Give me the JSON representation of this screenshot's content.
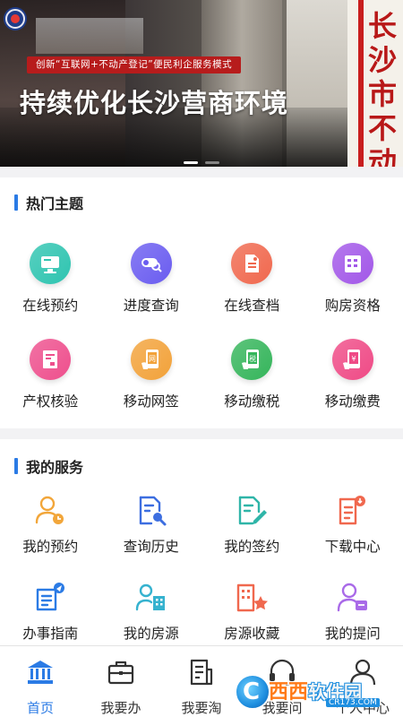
{
  "banner": {
    "slogan": "创新“互联网+不动产登记”便民利企服务模式",
    "headline": "持续优化长沙营商环境",
    "sign_text": "长沙市不动产",
    "slides": 2,
    "active_slide": 0
  },
  "hot_topics": {
    "title": "热门主题",
    "items": [
      {
        "label": "在线预约",
        "icon": "monitor-icon",
        "color": "#2ec4b0"
      },
      {
        "label": "进度查询",
        "icon": "progress-search-icon",
        "color": "#6a5cf0"
      },
      {
        "label": "在线查档",
        "icon": "document-icon",
        "color": "#f0684e"
      },
      {
        "label": "购房资格",
        "icon": "building-icon",
        "color": "#a257e8"
      },
      {
        "label": "产权核验",
        "icon": "certificate-icon",
        "color": "#ee4f8d"
      },
      {
        "label": "移动网签",
        "icon": "mobile-sign-icon",
        "color": "#f2a23a"
      },
      {
        "label": "移动缴税",
        "icon": "mobile-tax-icon",
        "color": "#35b55b"
      },
      {
        "label": "移动缴费",
        "icon": "mobile-pay-icon",
        "color": "#ef4a86"
      }
    ]
  },
  "my_services": {
    "title": "我的服务",
    "items": [
      {
        "label": "我的预约",
        "icon": "user-clock-icon",
        "color": "#f2a63a"
      },
      {
        "label": "查询历史",
        "icon": "search-history-icon",
        "color": "#3d6ee0"
      },
      {
        "label": "我的签约",
        "icon": "sign-pen-icon",
        "color": "#2fb5a8"
      },
      {
        "label": "下载中心",
        "icon": "download-doc-icon",
        "color": "#f0684e"
      },
      {
        "label": "办事指南",
        "icon": "guide-icon",
        "color": "#2b7be5"
      },
      {
        "label": "我的房源",
        "icon": "user-building-icon",
        "color": "#35b2cf"
      },
      {
        "label": "房源收藏",
        "icon": "building-star-icon",
        "color": "#f0684e"
      },
      {
        "label": "我的提问",
        "icon": "user-question-icon",
        "color": "#a96ae8"
      }
    ]
  },
  "tabbar": {
    "items": [
      {
        "label": "首页",
        "icon": "home-bank-icon",
        "active": true
      },
      {
        "label": "我要办",
        "icon": "briefcase-icon",
        "active": false
      },
      {
        "label": "我要淘",
        "icon": "document-list-icon",
        "active": false
      },
      {
        "label": "我要问",
        "icon": "headset-icon",
        "active": false
      },
      {
        "label": "个人中心",
        "icon": "person-icon",
        "active": false
      }
    ]
  },
  "watermark": {
    "brand_a": "西西",
    "brand_b": "软件园",
    "site": "CR173.COM"
  },
  "colors": {
    "accent": "#2b7be5",
    "banner_red": "#b71c1c"
  }
}
